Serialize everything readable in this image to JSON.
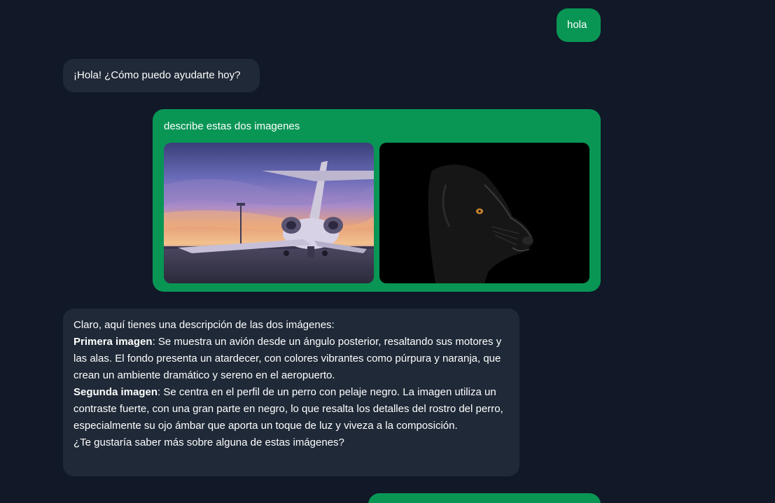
{
  "messages": [
    {
      "role": "user",
      "text": "hola"
    },
    {
      "role": "assistant",
      "text": "¡Hola! ¿Cómo puedo ayudarte hoy?"
    },
    {
      "role": "user",
      "text": "describe estas dos imagenes",
      "images": [
        {
          "icon": "airplane-photo",
          "depicts": "jet"
        },
        {
          "icon": "dog-photo",
          "depicts": "dog"
        }
      ]
    },
    {
      "role": "assistant",
      "intro": "Claro, aquí tienes una descripción de las dos imágenes:",
      "item1_label": "Primera imagen",
      "item1_text": ": Se muestra un avión desde un ángulo posterior, resaltando sus motores y las alas. El fondo presenta un atardecer, con colores vibrantes como púrpura y naranja, que crean un ambiente dramático y sereno en el aeropuerto.",
      "item2_label": "Segunda imagen",
      "item2_text": ": Se centra en el perfil de un perro con pelaje negro. La imagen utiliza un contraste fuerte, con una gran parte en negro, lo que resalta los detalles del rostro del perro, especialmente su ojo ámbar que aporta un toque de luz y viveza a la composición.",
      "outro": "¿Te gustaría saber más sobre alguna de estas imágenes?"
    },
    {
      "role": "user",
      "text": ""
    }
  ],
  "colors": {
    "background": "#111827",
    "user_bubble": "#099655",
    "assistant_bubble": "#1f2937",
    "text": "#ffffff"
  }
}
